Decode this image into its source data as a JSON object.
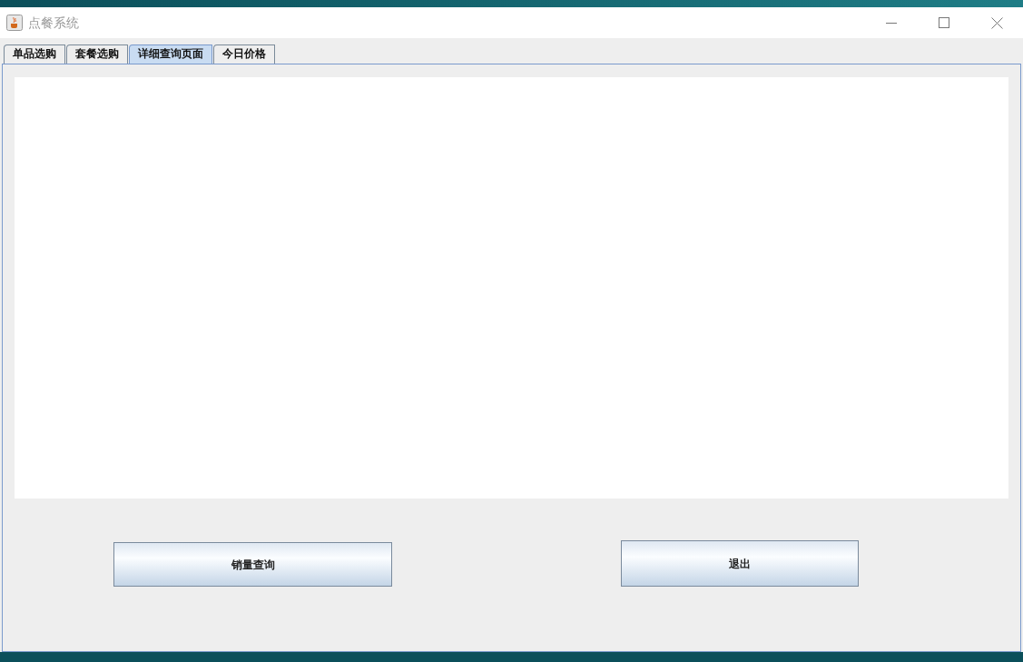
{
  "window": {
    "title": "点餐系统"
  },
  "tabs": [
    {
      "label": "单品选购",
      "selected": false
    },
    {
      "label": "套餐选购",
      "selected": false
    },
    {
      "label": "详细查询页面",
      "selected": true
    },
    {
      "label": "今日价格",
      "selected": false
    }
  ],
  "buttons": [
    {
      "label": "销量查询"
    },
    {
      "label": "退出"
    }
  ]
}
